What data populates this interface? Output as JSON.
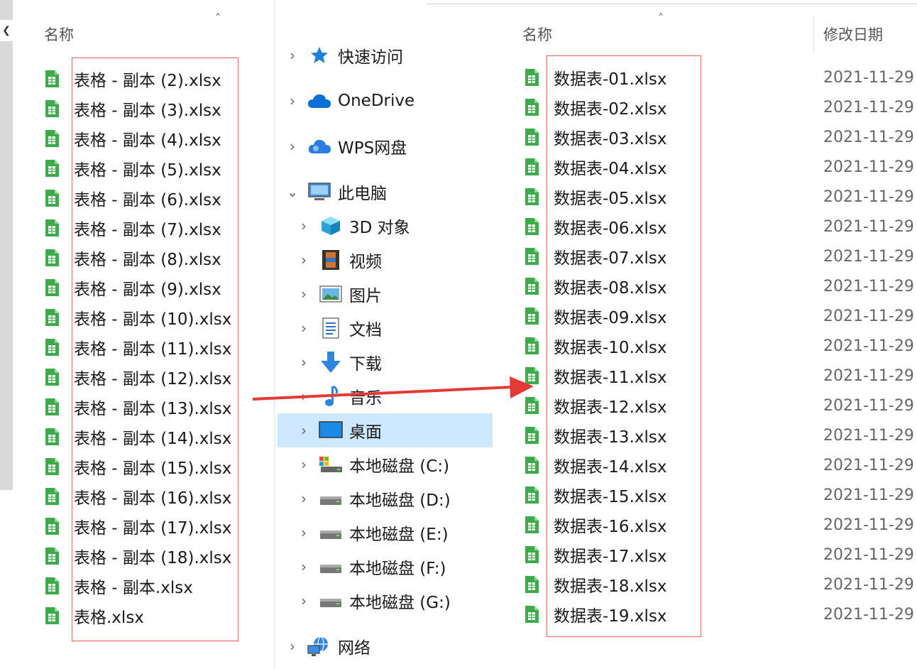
{
  "left_pane": {
    "column_header": "名称",
    "files": [
      "表格 - 副本 (2).xlsx",
      "表格 - 副本 (3).xlsx",
      "表格 - 副本 (4).xlsx",
      "表格 - 副本 (5).xlsx",
      "表格 - 副本 (6).xlsx",
      "表格 - 副本 (7).xlsx",
      "表格 - 副本 (8).xlsx",
      "表格 - 副本 (9).xlsx",
      "表格 - 副本 (10).xlsx",
      "表格 - 副本 (11).xlsx",
      "表格 - 副本 (12).xlsx",
      "表格 - 副本 (13).xlsx",
      "表格 - 副本 (14).xlsx",
      "表格 - 副本 (15).xlsx",
      "表格 - 副本 (16).xlsx",
      "表格 - 副本 (17).xlsx",
      "表格 - 副本 (18).xlsx",
      "表格 - 副本.xlsx",
      "表格.xlsx"
    ]
  },
  "nav": {
    "quick_access": "快速访问",
    "onedrive": "OneDrive",
    "wps": "WPS网盘",
    "this_pc": "此电脑",
    "objects3d": "3D 对象",
    "videos": "视频",
    "pictures": "图片",
    "documents": "文档",
    "downloads": "下载",
    "music": "音乐",
    "desktop": "桌面",
    "drive_c": "本地磁盘 (C:)",
    "drive_d": "本地磁盘 (D:)",
    "drive_e": "本地磁盘 (E:)",
    "drive_f": "本地磁盘 (F:)",
    "drive_g": "本地磁盘 (G:)",
    "network": "网络"
  },
  "right_pane": {
    "column_name": "名称",
    "column_date": "修改日期",
    "files": [
      {
        "name": "数据表-01.xlsx",
        "date": "2021-11-29"
      },
      {
        "name": "数据表-02.xlsx",
        "date": "2021-11-29"
      },
      {
        "name": "数据表-03.xlsx",
        "date": "2021-11-29"
      },
      {
        "name": "数据表-04.xlsx",
        "date": "2021-11-29"
      },
      {
        "name": "数据表-05.xlsx",
        "date": "2021-11-29"
      },
      {
        "name": "数据表-06.xlsx",
        "date": "2021-11-29"
      },
      {
        "name": "数据表-07.xlsx",
        "date": "2021-11-29"
      },
      {
        "name": "数据表-08.xlsx",
        "date": "2021-11-29"
      },
      {
        "name": "数据表-09.xlsx",
        "date": "2021-11-29"
      },
      {
        "name": "数据表-10.xlsx",
        "date": "2021-11-29"
      },
      {
        "name": "数据表-11.xlsx",
        "date": "2021-11-29"
      },
      {
        "name": "数据表-12.xlsx",
        "date": "2021-11-29"
      },
      {
        "name": "数据表-13.xlsx",
        "date": "2021-11-29"
      },
      {
        "name": "数据表-14.xlsx",
        "date": "2021-11-29"
      },
      {
        "name": "数据表-15.xlsx",
        "date": "2021-11-29"
      },
      {
        "name": "数据表-16.xlsx",
        "date": "2021-11-29"
      },
      {
        "name": "数据表-17.xlsx",
        "date": "2021-11-29"
      },
      {
        "name": "数据表-18.xlsx",
        "date": "2021-11-29"
      },
      {
        "name": "数据表-19.xlsx",
        "date": "2021-11-29"
      }
    ]
  },
  "colors": {
    "highlight_box": "#e8615a",
    "arrow": "#e53935",
    "selected_nav": "#cde8ff",
    "xlsx_icon": "#3dab49"
  }
}
